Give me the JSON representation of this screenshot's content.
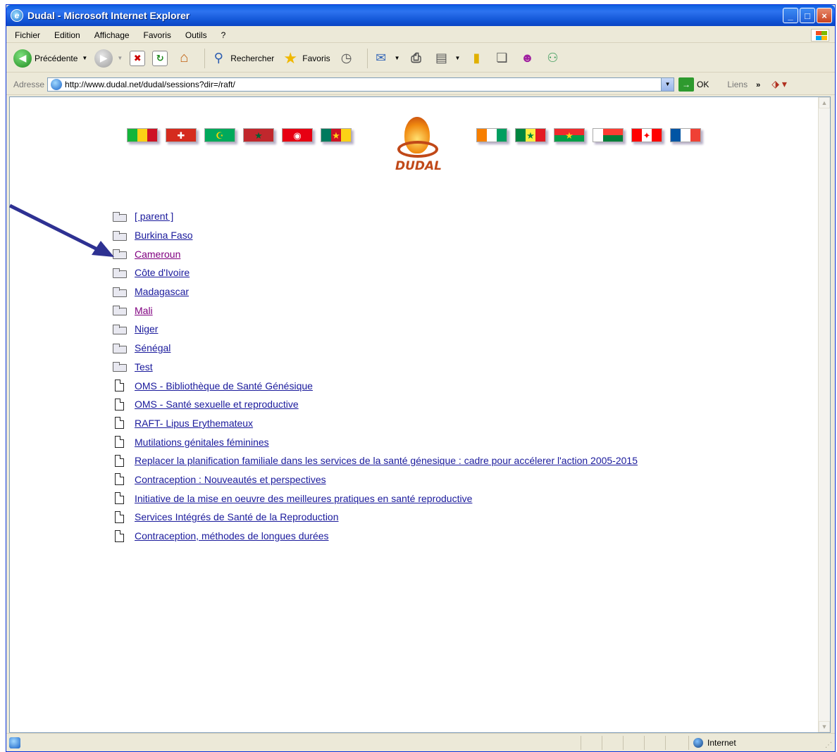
{
  "window": {
    "title": "Dudal - Microsoft Internet Explorer",
    "buttons": {
      "minimize": "_",
      "maximize": "□",
      "close": "×"
    }
  },
  "menu": [
    "Fichier",
    "Edition",
    "Affichage",
    "Favoris",
    "Outils",
    "?"
  ],
  "toolbar": {
    "back_label": "Précédente",
    "search_label": "Rechercher",
    "favorites_label": "Favoris"
  },
  "address": {
    "label": "Adresse",
    "url": "http://www.dudal.net/dudal/sessions?dir=/raft/",
    "go_label": "OK",
    "links_label": "Liens"
  },
  "page": {
    "logo_text": "DUDAL",
    "flags_left": [
      {
        "name": "mali",
        "colors": [
          "#14b53a",
          "#fcd116",
          "#ce1126"
        ],
        "dir": "v"
      },
      {
        "name": "suisse",
        "colors": [
          "#d52b1e"
        ],
        "symbol": "✚",
        "symbol_color": "#ffffff"
      },
      {
        "name": "mauritanie",
        "colors": [
          "#00a95c"
        ],
        "symbol": "☪",
        "symbol_color": "#ffd700"
      },
      {
        "name": "maroc",
        "colors": [
          "#c1272d"
        ],
        "symbol": "★",
        "symbol_color": "#006233"
      },
      {
        "name": "tunisie",
        "colors": [
          "#e70013"
        ],
        "symbol": "◉",
        "symbol_color": "#ffffff"
      },
      {
        "name": "cameroun",
        "colors": [
          "#007a5e",
          "#ce1126",
          "#fcd116"
        ],
        "dir": "v",
        "symbol": "★",
        "symbol_color": "#fcd116"
      }
    ],
    "flags_right": [
      {
        "name": "cote-divoire",
        "colors": [
          "#f77f00",
          "#ffffff",
          "#009e60"
        ],
        "dir": "v"
      },
      {
        "name": "senegal",
        "colors": [
          "#00853f",
          "#fdef42",
          "#e31b23"
        ],
        "dir": "v",
        "symbol": "★",
        "symbol_color": "#00853f"
      },
      {
        "name": "burkina-faso",
        "colors": [
          "#ef2b2d",
          "#009e49"
        ],
        "dir": "h",
        "symbol": "★",
        "symbol_color": "#fcd116"
      },
      {
        "name": "madagascar",
        "colors": [
          "#ffffff",
          "#fc3d32",
          "#007e3a"
        ],
        "dir": "mg"
      },
      {
        "name": "canada",
        "colors": [
          "#ff0000",
          "#ffffff",
          "#ff0000"
        ],
        "dir": "v",
        "symbol": "✦",
        "symbol_color": "#ff0000"
      },
      {
        "name": "france",
        "colors": [
          "#0055a4",
          "#ffffff",
          "#ef4135"
        ],
        "dir": "v"
      }
    ],
    "folders": [
      {
        "label": "[ parent ]",
        "visited": false
      },
      {
        "label": "Burkina Faso",
        "visited": false
      },
      {
        "label": "Cameroun",
        "visited": true
      },
      {
        "label": "Côte d'Ivoire",
        "visited": false
      },
      {
        "label": "Madagascar",
        "visited": false
      },
      {
        "label": "Mali",
        "visited": true
      },
      {
        "label": "Niger",
        "visited": false
      },
      {
        "label": "Sénégal",
        "visited": false
      },
      {
        "label": "Test",
        "visited": false
      }
    ],
    "files": [
      "OMS - Bibliothèque de Santé Génésique",
      "OMS - Santé sexuelle et reproductive",
      "RAFT- Lipus Erythemateux",
      "Mutilations génitales féminines",
      "Replacer la planification familiale dans les services de la santé génesique : cadre pour accélerer l'action 2005-2015",
      "Contraception : Nouveautés et perspectives",
      "Initiative de la mise en oeuvre des meilleures pratiques en santé reproductive",
      "Services Intégrés de Santé de la Reproduction",
      "Contraception, méthodes de longues durées"
    ]
  },
  "status": {
    "zone": "Internet"
  },
  "colors": {
    "link": "#1a1a9c",
    "visited": "#800080",
    "arrow": "#2e3192"
  }
}
